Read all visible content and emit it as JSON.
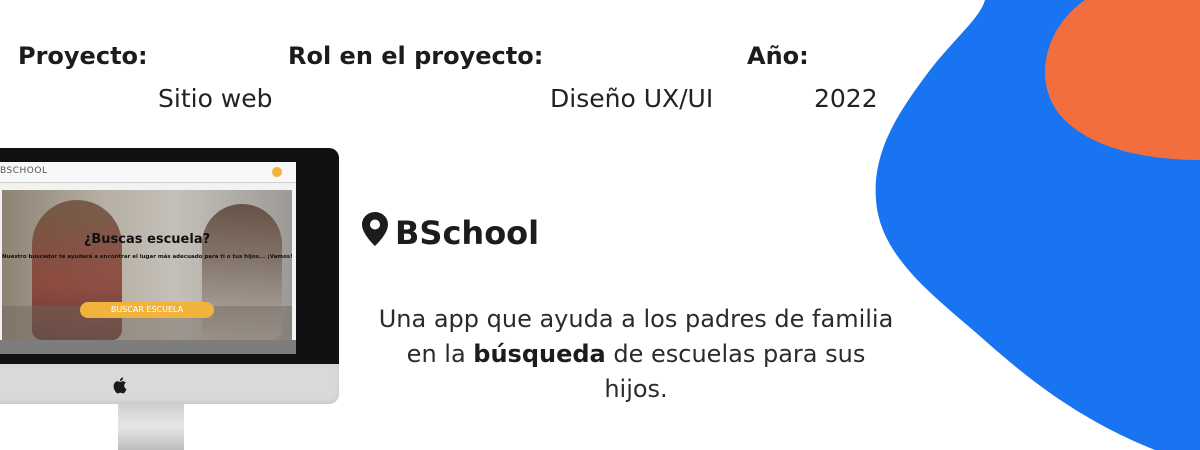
{
  "colors": {
    "blue_blob": "#1874f0",
    "orange_blob": "#f36e3e",
    "cta": "#f2b33d"
  },
  "meta": {
    "project_label": "Proyecto:",
    "project_value": "Sitio web",
    "role_label": "Rol en el proyecto:",
    "role_value": "Diseño UX/UI",
    "year_label": "Año:",
    "year_value": "2022"
  },
  "mockup": {
    "app_logo": "BSCHOOL",
    "hero_title": "¿Buscas escuela?",
    "hero_subtitle": "Nuestro buscador te ayudará a encontrar el lugar más adecuado para ti o tus hijos... ¡Vamos!",
    "cta_label": "BUSCAR ESCUELA"
  },
  "brand": {
    "name": "BSchool",
    "pin_icon": "location-pin-icon"
  },
  "description": {
    "before": "Una app que ayuda a los padres de familia en la ",
    "emphasis": "búsqueda",
    "after": " de escuelas para sus hijos."
  }
}
